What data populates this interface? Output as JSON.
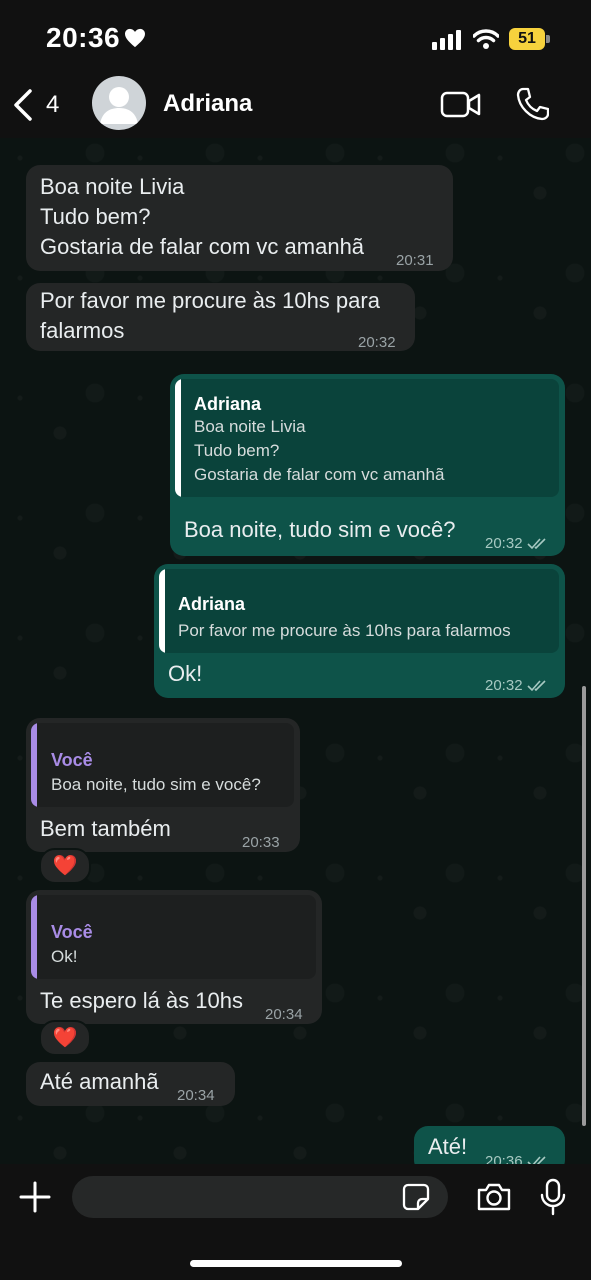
{
  "status_bar": {
    "time": "20:36",
    "battery": "51"
  },
  "header": {
    "back_count": "4",
    "contact_name": "Adriana"
  },
  "messages": [
    {
      "id": "m1",
      "lines": [
        "Boa noite Livia",
        "Tudo bem?",
        "Gostaria de falar com vc amanhã"
      ],
      "time": "20:31"
    },
    {
      "id": "m2",
      "lines": [
        "Por favor me procure às 10hs para",
        "falarmos"
      ],
      "time": "20:32"
    },
    {
      "id": "m3",
      "quote_name": "Adriana",
      "quote_lines": [
        "Boa noite Livia",
        "Tudo bem?",
        "Gostaria de falar com vc amanhã"
      ],
      "text": "Boa noite, tudo sim e você?",
      "time": "20:32"
    },
    {
      "id": "m4",
      "quote_name": "Adriana",
      "quote_lines": [
        "Por favor me procure às 10hs para falarmos"
      ],
      "text": "Ok!",
      "time": "20:32"
    },
    {
      "id": "m5",
      "quote_name": "Você",
      "quote_lines": [
        "Boa noite, tudo sim e você?"
      ],
      "text": "Bem também",
      "time": "20:33",
      "reaction": "❤️"
    },
    {
      "id": "m6",
      "quote_name": "Você",
      "quote_lines": [
        "Ok!"
      ],
      "text": "Te espero lá às 10hs",
      "time": "20:34",
      "reaction": "❤️"
    },
    {
      "id": "m7",
      "text": "Até amanhã",
      "time": "20:34"
    },
    {
      "id": "m8",
      "text": "Até!",
      "time": "20:36"
    }
  ],
  "input": {
    "placeholder": "",
    "value": ""
  },
  "colors": {
    "incoming": "#242626",
    "outgoing": "#0e5349",
    "quote_accent_you": "#a98ce6",
    "battery": "#f7d23d"
  },
  "icons": [
    "heart-icon",
    "signal-icon",
    "wifi-icon",
    "back-chevron-icon",
    "avatar-icon",
    "video-call-icon",
    "phone-icon",
    "double-check-icon",
    "plus-icon",
    "sticker-icon",
    "camera-icon",
    "mic-icon"
  ]
}
